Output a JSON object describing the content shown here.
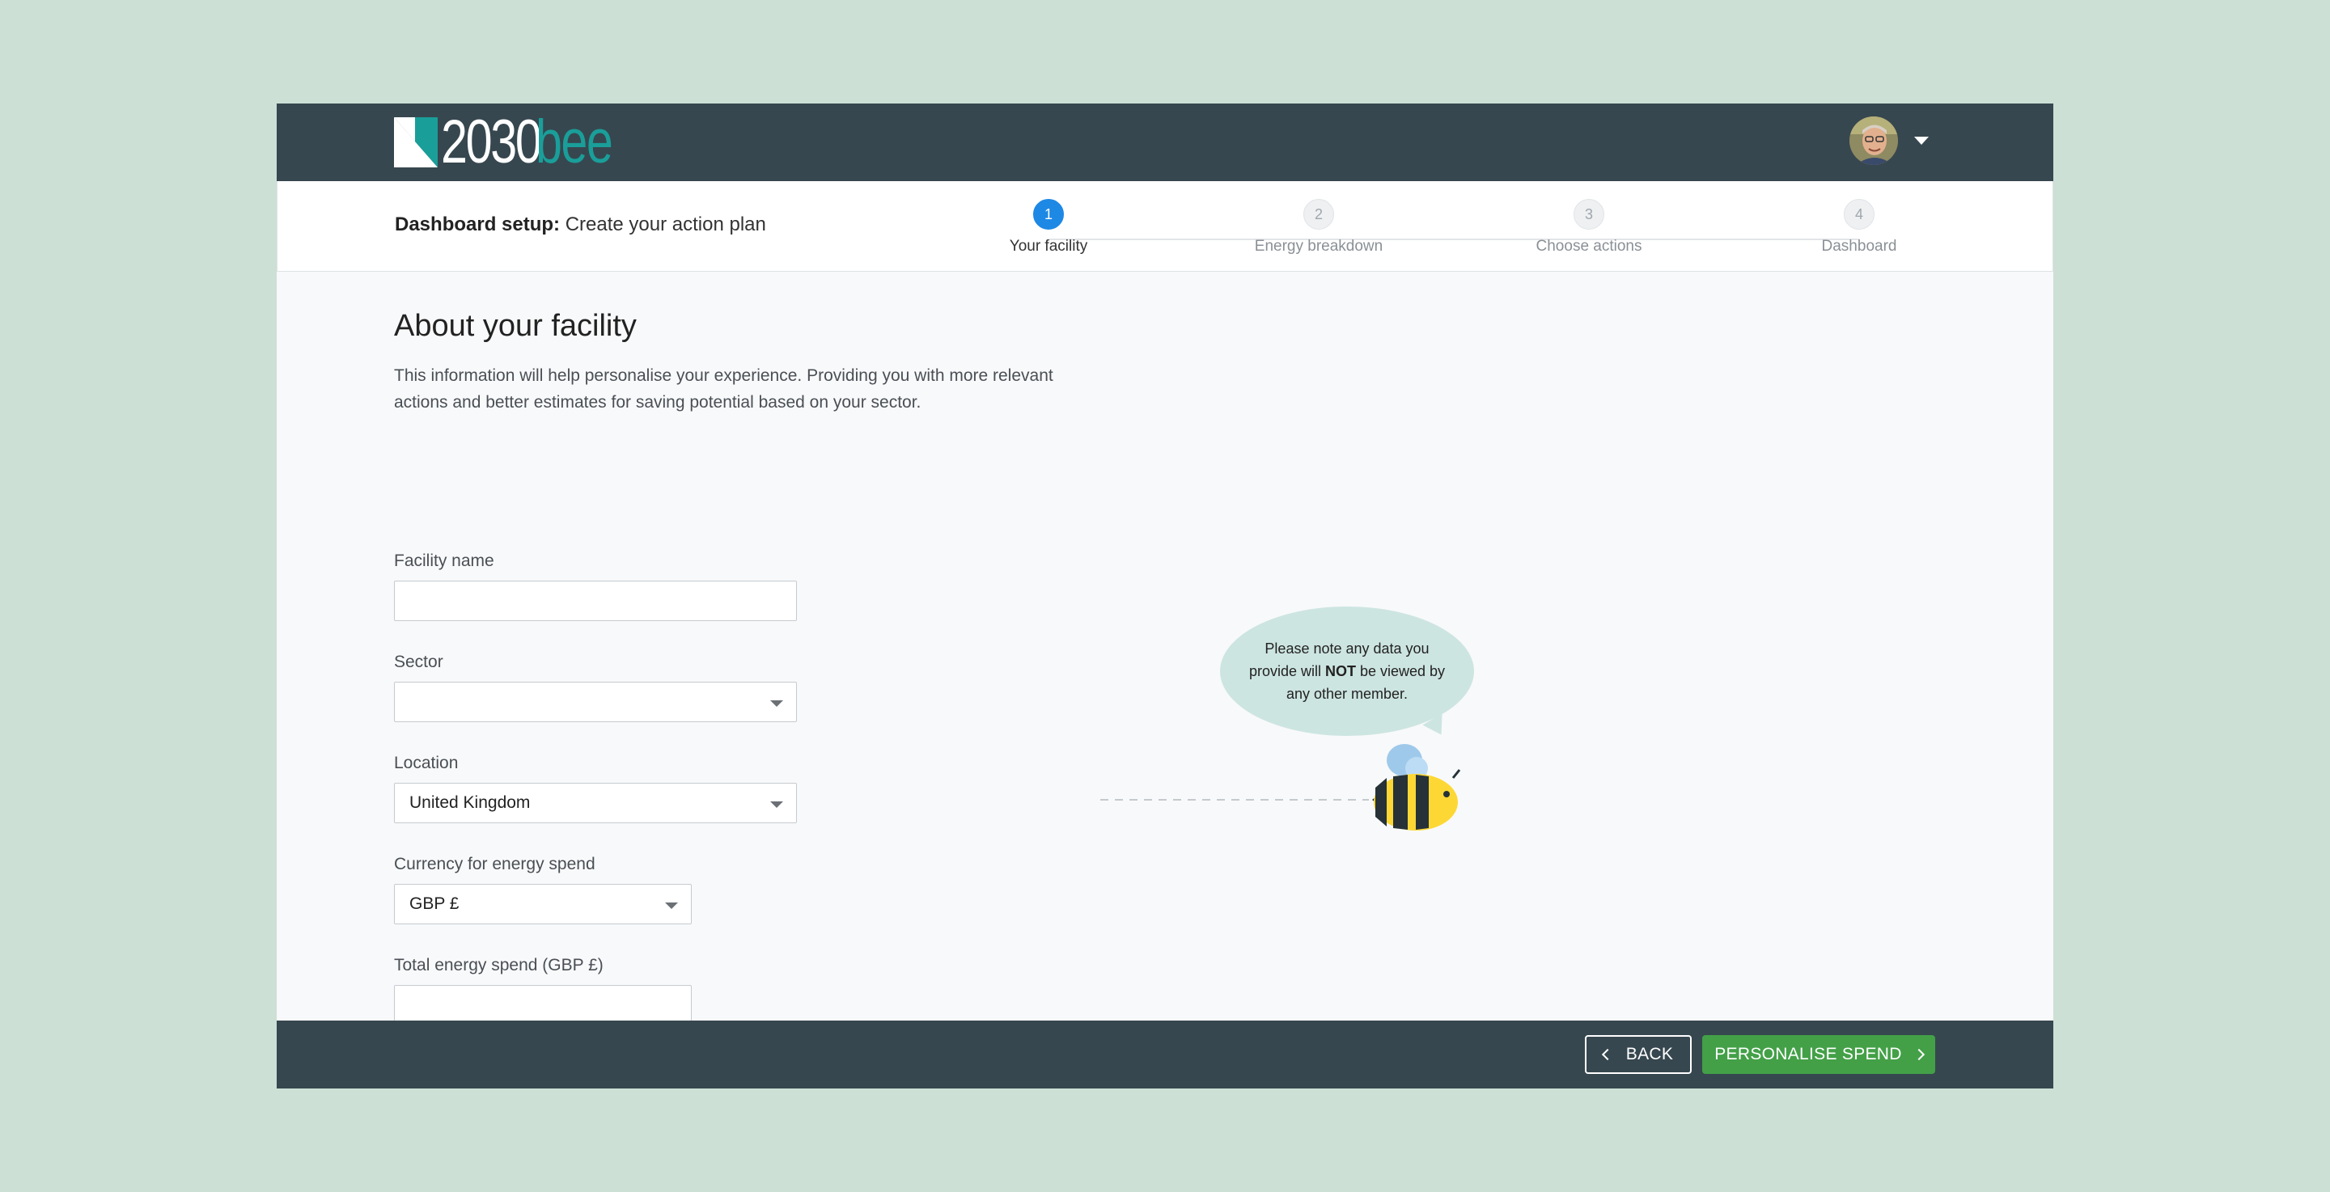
{
  "header": {
    "logo_number": "2030",
    "logo_word": "bee"
  },
  "setup": {
    "title_bold": "Dashboard setup:",
    "title_rest": " Create your action plan"
  },
  "steps": [
    {
      "number": "1",
      "label": "Your facility",
      "active": true
    },
    {
      "number": "2",
      "label": "Energy breakdown",
      "active": false
    },
    {
      "number": "3",
      "label": "Choose actions",
      "active": false
    },
    {
      "number": "4",
      "label": "Dashboard",
      "active": false
    }
  ],
  "main": {
    "title": "About your facility",
    "description": "This information will help personalise your experience. Providing you with more relevant actions and better estimates for saving potential based on your sector."
  },
  "form": {
    "facility_name": {
      "label": "Facility name",
      "value": ""
    },
    "sector": {
      "label": "Sector",
      "value": ""
    },
    "location": {
      "label": "Location",
      "value": "United Kingdom"
    },
    "currency": {
      "label": "Currency for energy spend",
      "value": "GBP £"
    },
    "total_spend": {
      "label": "Total energy spend (GBP £)",
      "value": ""
    }
  },
  "bubble": {
    "text_before": "Please note any data you provide will ",
    "text_bold": "NOT",
    "text_after": " be viewed by any other member."
  },
  "footer": {
    "back_label": "BACK",
    "next_label": "PERSONALISE SPEND"
  },
  "colors": {
    "page_background": "#cce0d5",
    "header_background": "#37474f",
    "brand_teal": "#1a9e99",
    "step_active": "#1e88e5",
    "primary_button": "#43a047",
    "bubble": "#cde5e1",
    "bee_yellow": "#fdd835"
  }
}
